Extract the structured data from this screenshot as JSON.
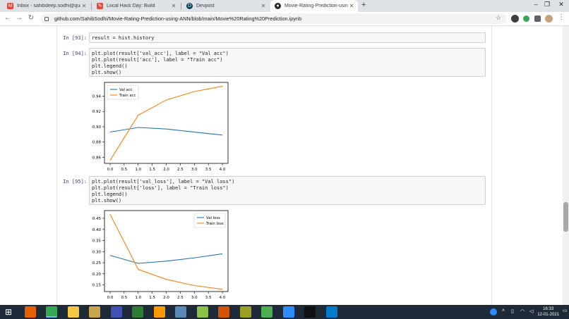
{
  "browser": {
    "tabs": [
      {
        "title": "Inbox - sahibdeep.sodhi@quantiph",
        "icon": "gmail-icon",
        "color": "#ea4335",
        "active": false
      },
      {
        "title": "Local Hack Day: Build",
        "icon": "mlh-icon",
        "color": "#e24a3b",
        "active": false
      },
      {
        "title": "Devpost",
        "icon": "devpost-icon",
        "color": "#003e54",
        "active": false
      },
      {
        "title": "Movie-Rating-Prediction-using-AN",
        "icon": "github-icon",
        "color": "#24292e",
        "active": true
      }
    ],
    "new_tab": "+",
    "url": "github.com/SahibSodhi/Movie-Rating-Prediction-using-ANN/blob/main/Movie%20Rating%20Prediction.ipynb"
  },
  "notebook": {
    "cells": [
      {
        "prompt": "In [93]:",
        "code": [
          "result = hist.history"
        ]
      },
      {
        "prompt": "In [94]:",
        "code": [
          "plt.plot(result['val_acc'], label = \"Val acc\")",
          "plt.plot(result['acc'], label = \"Train acc\")",
          "plt.legend()",
          "plt.show()"
        ]
      },
      {
        "prompt": "In [95]:",
        "code": [
          "plt.plot(result['val_loss'], label = \"Val loss\")",
          "plt.plot(result['loss'], label = \"Train loss\")",
          "plt.legend()",
          "plt.show()"
        ]
      }
    ]
  },
  "chart_data": [
    {
      "type": "line",
      "x": [
        0,
        1,
        2,
        3,
        4
      ],
      "xticks": [
        "0.0",
        "0.5",
        "1.0",
        "1.5",
        "2.0",
        "2.5",
        "3.0",
        "3.5",
        "4.0"
      ],
      "yticks": [
        "0.86",
        "0.88",
        "0.90",
        "0.92",
        "0.94"
      ],
      "ylim": [
        0.852,
        0.958
      ],
      "xlim": [
        -0.2,
        4.2
      ],
      "legend_position": "top-left",
      "series": [
        {
          "name": "Val acc",
          "color": "#1f77b4",
          "values": [
            0.893,
            0.899,
            0.897,
            0.893,
            0.889
          ]
        },
        {
          "name": "Train acc",
          "color": "#ff7f0e",
          "values": [
            0.856,
            0.915,
            0.935,
            0.946,
            0.953
          ]
        }
      ]
    },
    {
      "type": "line",
      "x": [
        0,
        1,
        2,
        3,
        4
      ],
      "xticks": [
        "0.0",
        "0.5",
        "1.0",
        "1.5",
        "2.0",
        "2.5",
        "3.0",
        "3.5",
        "4.0"
      ],
      "yticks": [
        "0.15",
        "0.20",
        "0.25",
        "0.30",
        "0.35",
        "0.40",
        "0.45"
      ],
      "ylim": [
        0.12,
        0.485
      ],
      "xlim": [
        -0.2,
        4.2
      ],
      "legend_position": "top-right",
      "series": [
        {
          "name": "Val loss",
          "color": "#1f77b4",
          "values": [
            0.283,
            0.247,
            0.257,
            0.272,
            0.29
          ]
        },
        {
          "name": "Train loss",
          "color": "#ff7f0e",
          "values": [
            0.468,
            0.22,
            0.175,
            0.147,
            0.13
          ]
        }
      ]
    }
  ],
  "taskbar": {
    "time": "16:33",
    "date": "12-01-2021",
    "apps": [
      {
        "name": "start-icon",
        "color": "#1f2a38"
      },
      {
        "name": "firefox-icon",
        "color": "#e66000"
      },
      {
        "name": "chrome-icon",
        "color": "#34a853"
      },
      {
        "name": "file-explorer-icon",
        "color": "#f2c744"
      },
      {
        "name": "photos-icon",
        "color": "#c9a64a"
      },
      {
        "name": "dev-icon",
        "color": "#3f51b5"
      },
      {
        "name": "sheets-icon",
        "color": "#2e7d32"
      },
      {
        "name": "sublime-icon",
        "color": "#ff9800"
      },
      {
        "name": "virtualbox-icon",
        "color": "#5c8ab8"
      },
      {
        "name": "colour-grid-icon",
        "color": "#8bc34a"
      },
      {
        "name": "matlab-icon",
        "color": "#d35400"
      },
      {
        "name": "pen-icon",
        "color": "#9e9d24"
      },
      {
        "name": "utorrent-icon",
        "color": "#4caf50"
      },
      {
        "name": "zoom-icon",
        "color": "#2d8cff"
      },
      {
        "name": "terminal-icon",
        "color": "#111111"
      },
      {
        "name": "vscode-icon",
        "color": "#007acc"
      }
    ]
  }
}
